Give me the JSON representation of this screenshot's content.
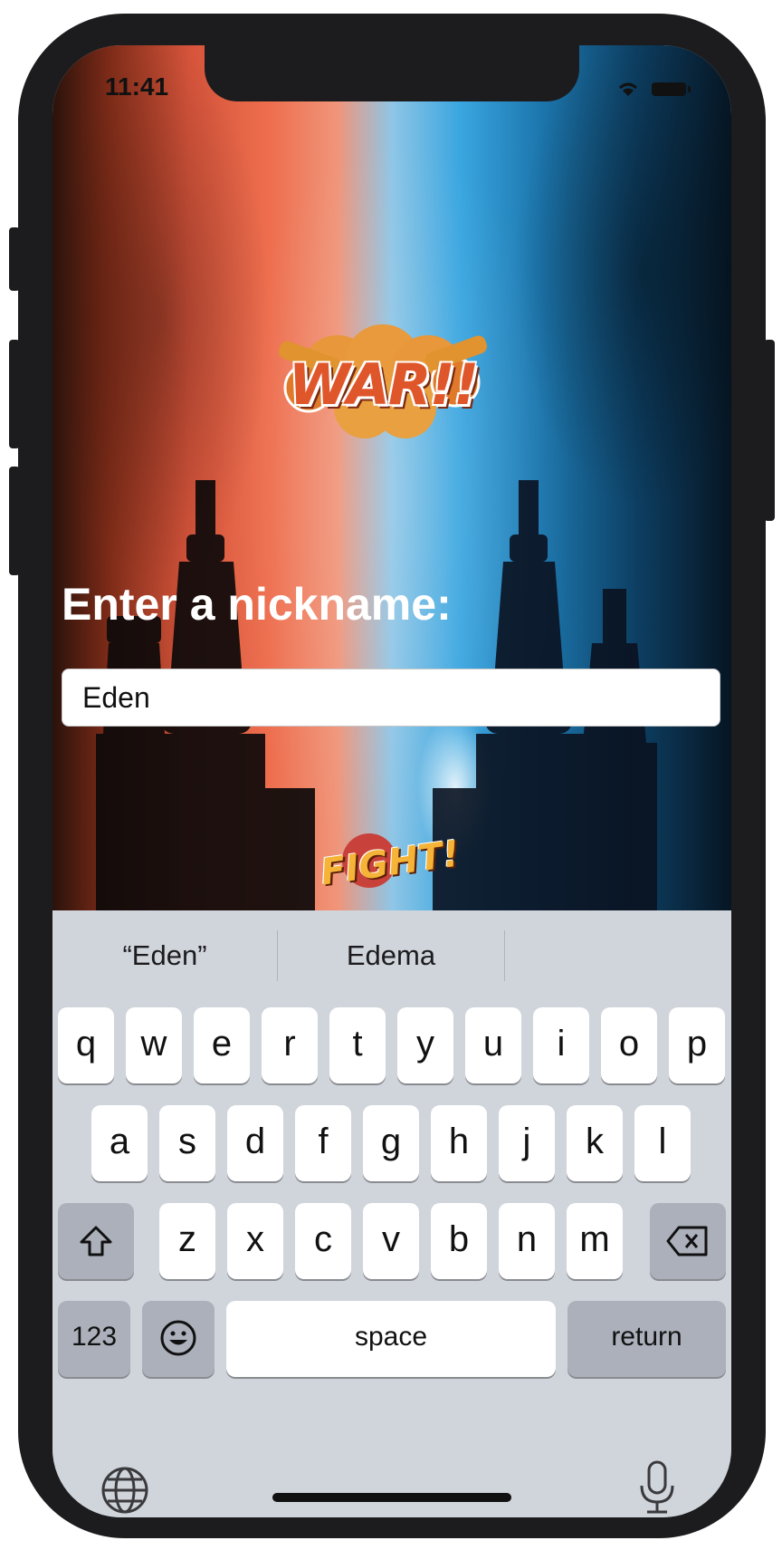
{
  "status": {
    "time": "11:41"
  },
  "app": {
    "logo_text": "WAR!!",
    "prompt": "Enter a nickname:",
    "nickname_value": "Eden",
    "fight_text": "FIGHT!"
  },
  "keyboard": {
    "suggestions": [
      "“Eden”",
      "Edema",
      ""
    ],
    "row1": [
      "q",
      "w",
      "e",
      "r",
      "t",
      "y",
      "u",
      "i",
      "o",
      "p"
    ],
    "row2": [
      "a",
      "s",
      "d",
      "f",
      "g",
      "h",
      "j",
      "k",
      "l"
    ],
    "row3": [
      "z",
      "x",
      "c",
      "v",
      "b",
      "n",
      "m"
    ],
    "numbers_key": "123",
    "space_key": "space",
    "return_key": "return",
    "icons": [
      "shift-icon",
      "delete-icon",
      "emoji-icon",
      "globe-icon",
      "microphone-icon"
    ]
  }
}
